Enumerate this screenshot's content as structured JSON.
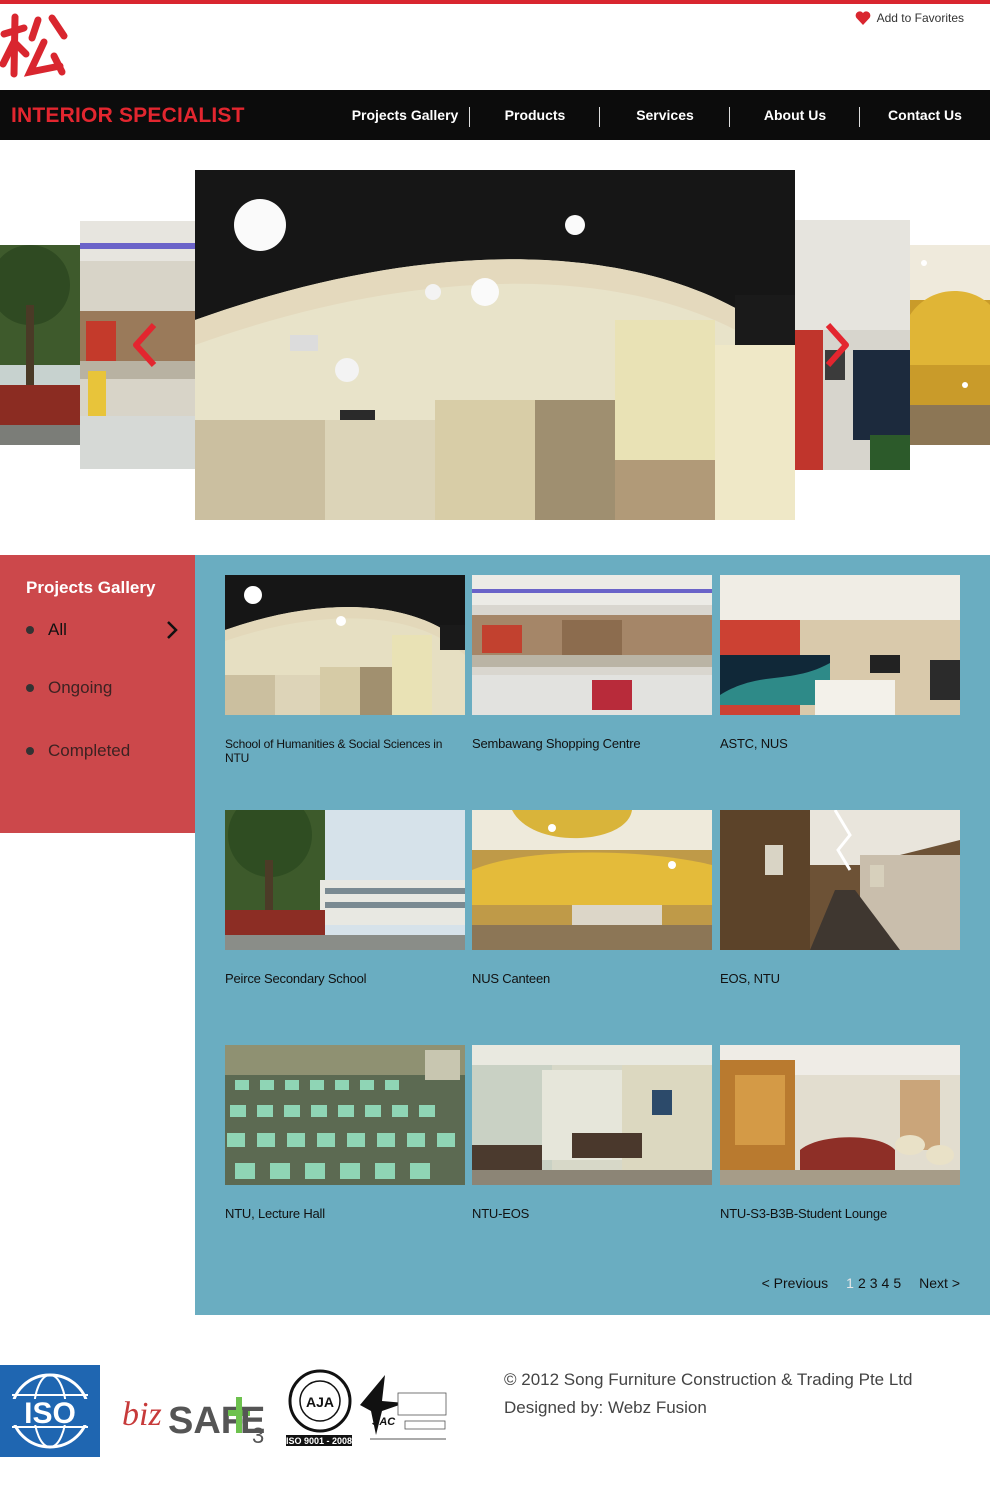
{
  "header": {
    "favorites_label": "Add to Favorites",
    "brand": "INTERIOR SPECIALIST",
    "nav": [
      "Projects Gallery",
      "Products",
      "Services",
      "About Us",
      "Contact Us"
    ]
  },
  "sidebar": {
    "title": "Projects Gallery",
    "items": [
      "All",
      "Ongoing",
      "Completed"
    ]
  },
  "gallery": {
    "projects": [
      "School of Humanities & Social Sciences in NTU",
      "Sembawang Shopping Centre",
      "ASTC, NUS",
      "Peirce Secondary School",
      "NUS Canteen",
      "EOS, NTU",
      "NTU, Lecture Hall",
      "NTU-EOS",
      "NTU-S3-B3B-Student Lounge"
    ],
    "pager": {
      "prev": "< Previous",
      "pages": [
        "1",
        "2",
        "3",
        "4",
        "5"
      ],
      "next": "Next >"
    }
  },
  "footer": {
    "copyright": "© 2012 Song Furniture Construction & Trading Pte Ltd",
    "designed_by": "Designed by: Webz Fusion"
  },
  "colors": {
    "accent_red": "#d9262f",
    "sidebar_red": "#cc484b",
    "gallery_blue": "#6aadc1",
    "navbar_black": "#0c0c0c"
  }
}
